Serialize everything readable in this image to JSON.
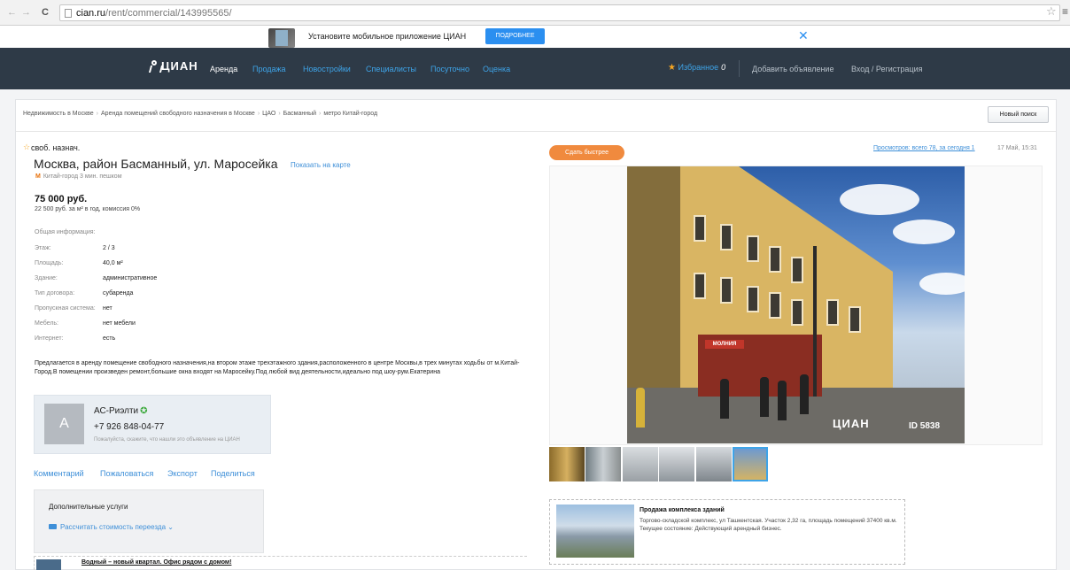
{
  "browser": {
    "back": "←",
    "forward": "→",
    "reload": "C",
    "url_host": "cian.ru",
    "url_path": "/rent/commercial/143995565/",
    "star": "☆",
    "menu": "≡"
  },
  "app_banner": {
    "text": "Установите мобильное приложение ЦИАН",
    "button": "ПОДРОБНЕЕ",
    "close": "✕"
  },
  "nav": {
    "logo": "ЦИАН",
    "items": [
      "Аренда",
      "Продажа",
      "Новостройки",
      "Специалисты",
      "Посуточно",
      "Оценка"
    ],
    "favorites_label": "Избранное",
    "favorites_count": "0",
    "add_listing": "Добавить объявление",
    "login": "Вход / Регистрация"
  },
  "breadcrumb": {
    "items": [
      "Недвижимость в Москве",
      "Аренда помещений свободного назначения в Москве",
      "ЦАО",
      "Басманный",
      "метро Китай-город"
    ],
    "separator": "›"
  },
  "new_search_button": "Новый поиск",
  "listing": {
    "fav_star": "☆",
    "type": "своб. назнач.",
    "address": "Москва, район Басманный, ул. Маросейка",
    "show_on_map": "Показать на карте",
    "metro_icon": "M",
    "metro": "Китай-город 3 мин. пешком",
    "price": "75 000 руб.",
    "price_details": "22 500 руб. за м² в год, комиссия 0%",
    "general_info_label": "Общая информация:",
    "info": [
      {
        "label": "Этаж:",
        "value": "2 / 3"
      },
      {
        "label": "Площадь:",
        "value": "40,0 м²"
      },
      {
        "label": "Здание:",
        "value": "административное"
      },
      {
        "label": "Тип договора:",
        "value": "субаренда"
      },
      {
        "label": "Пропускная система:",
        "value": "нет"
      },
      {
        "label": "Мебель:",
        "value": "нет мебели"
      },
      {
        "label": "Интернет:",
        "value": "есть"
      }
    ],
    "description": "Предлагается в аренду помещение свободного назначения,на втором этаже трехэтажного здания,расположенного в центре Москвы,в трех минутах ходьбы от м.Китай-Город.В помещении произведен ремонт,большие окна входят на Маросейку.Под любой вид деятельности,идеально под шоу-рум.Екатерина"
  },
  "agent": {
    "avatar_letter": "А",
    "name": "АС-Риэлти",
    "badge_icon": "verified-icon",
    "phone": "+7 926 848-04-77",
    "note": "Пожалуйста, скажите, что нашли это объявление на ЦИАН"
  },
  "actions": [
    "Комментарий",
    "Пожаловаться",
    "Экспорт",
    "Поделиться"
  ],
  "services": {
    "title": "Дополнительные услуги",
    "link": "Рассчитать стоимость переезда ⌄"
  },
  "bottom_ad": {
    "title": "Водный – новый квартал. Офис рядом с домом!"
  },
  "right": {
    "faster_button": "Сдать быстрее",
    "views": "Просмотров: всего 78, за сегодня 1",
    "date": "17 Май, 15:31",
    "photo_watermark_logo": "ЦИАН",
    "photo_watermark_id": "ID 5838",
    "storefront_sign": "МОЛНИЯ",
    "thumbnail_count": 6,
    "selected_thumbnail": 6
  },
  "right_ad": {
    "title": "Продажа комплекса зданий",
    "text": "Торгово-складской комплекс, ул Ташкентская. Участок 2,32 га, площадь помещений 37400 кв.м. Текущее состояние: Действующий арендный бизнес."
  },
  "colors": {
    "nav_bg": "#2e3a47",
    "link": "#3e8fd8",
    "accent_orange": "#f08a3e",
    "banner_button": "#2b8ff0"
  }
}
